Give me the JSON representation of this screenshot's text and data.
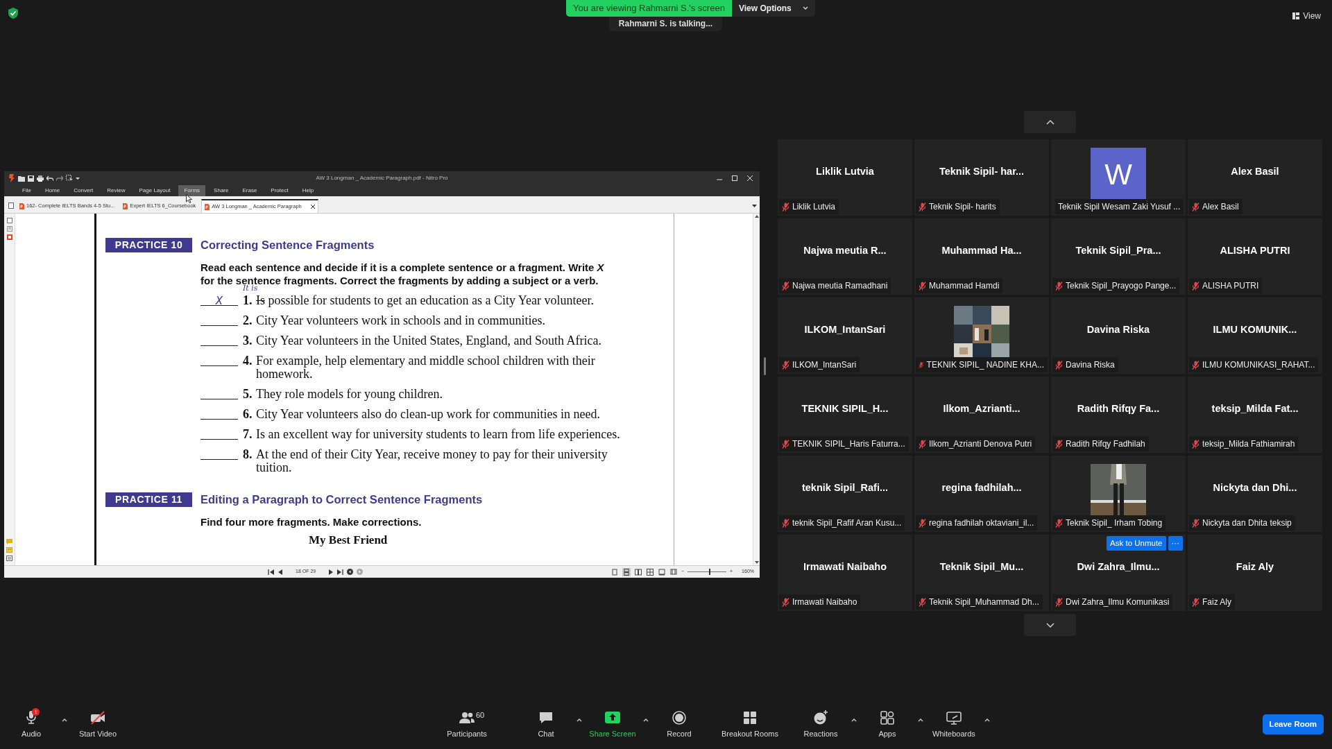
{
  "banner": {
    "text": "You are viewing Rahmarni S.'s screen",
    "options": "View Options"
  },
  "talking": "Rahmarni S. is talking...",
  "view_button": "View",
  "document_window": {
    "title": "AW 3 Longman _ Academic Paragraph.pdf - Nitro Pro",
    "ribbon": [
      {
        "label": "File",
        "selected": false
      },
      {
        "label": "Home",
        "selected": false
      },
      {
        "label": "Convert",
        "selected": false
      },
      {
        "label": "Review",
        "selected": false
      },
      {
        "label": "Page Layout",
        "selected": false
      },
      {
        "label": "Forms",
        "selected": true
      },
      {
        "label": "Share",
        "selected": false
      },
      {
        "label": "Erase",
        "selected": false
      },
      {
        "label": "Protect",
        "selected": false
      },
      {
        "label": "Help",
        "selected": false
      }
    ],
    "tabs": [
      {
        "label": "162- Complete IELTS Bands 4-5 Stu...",
        "selected": false
      },
      {
        "label": "Expert IELTS 6_Coursebook",
        "selected": false
      },
      {
        "label": "AW 3 Longman _ Academic Paragraph",
        "selected": true
      }
    ],
    "page": {
      "practices": [
        {
          "badge": "PRACTICE 10",
          "title": "Correcting Sentence Fragments",
          "instructions": "Read each sentence and decide if it is a complete sentence or a fragment. Write *X* for the sentence fragments. Correct the fragments by adding a subject or a verb.",
          "items": [
            {
              "number": "1.",
              "answer": "X",
              "correction": "It is",
              "struck": "Is",
              "text": "possible for students to get an education as a City Year volunteer."
            },
            {
              "number": "2.",
              "text": "City Year volunteers work in schools and in communities."
            },
            {
              "number": "3.",
              "text": "City Year volunteers in the United States, England, and South Africa."
            },
            {
              "number": "4.",
              "text": "For example, help elementary and middle school children with their homework."
            },
            {
              "number": "5.",
              "text": "They role models for young children."
            },
            {
              "number": "6.",
              "text": "City Year volunteers also do clean-up work for communities in need."
            },
            {
              "number": "7.",
              "text": "Is an excellent way for university students to learn from life experiences."
            },
            {
              "number": "8.",
              "text": "At the end of their City Year, receive money to pay for their university tuition."
            }
          ]
        },
        {
          "badge": "PRACTICE 11",
          "title": "Editing a Paragraph to Correct Sentence Fragments",
          "instructions": "Find four more fragments. Make corrections."
        }
      ],
      "subheading": "My Best Friend"
    },
    "status": {
      "page_counter": "18 OF 29",
      "history": [
        {
          "disabled": false
        },
        {
          "disabled": true
        }
      ],
      "view_modes": [
        {
          "selected": false
        },
        {
          "selected": true
        },
        {
          "selected": false
        },
        {
          "selected": false
        },
        {
          "selected": false
        },
        {
          "selected": false
        }
      ],
      "zoom_minus": "−",
      "zoom_plus": "+",
      "zoom": {
        "level": 0.58
      },
      "zoom_text": "160%"
    }
  },
  "participants": [
    {
      "kind": "name",
      "title": "Liklik Lutvia",
      "name": "Liklik Lutvia",
      "muted": true
    },
    {
      "kind": "name",
      "title": "Teknik Sipil- har...",
      "name": "Teknik Sipil- harits",
      "muted": true
    },
    {
      "kind": "avatar",
      "avatar": "W",
      "name": "Teknik Sipil Wesam Zaki Yusuf ...",
      "muted": false
    },
    {
      "kind": "name",
      "title": "Alex Basil",
      "name": "Alex Basil",
      "muted": true
    },
    {
      "kind": "name",
      "title": "Najwa meutia R...",
      "name": "Najwa meutia Ramadhani",
      "muted": true
    },
    {
      "kind": "name",
      "title": "Muhammad Ha...",
      "name": "Muhammad Hamdi",
      "muted": true
    },
    {
      "kind": "name",
      "title": "Teknik Sipil_Pra...",
      "name": "Teknik Sipil_Prayogo Pange...",
      "muted": true
    },
    {
      "kind": "name",
      "title": "ALISHA PUTRI",
      "name": "ALISHA PUTRI",
      "muted": true
    },
    {
      "kind": "name",
      "title": "ILKOM_IntanSari",
      "name": "ILKOM_IntanSari",
      "muted": true
    },
    {
      "kind": "picture",
      "name": "TEKNIK SIPIL_ NADINE KHA...",
      "muted": true
    },
    {
      "kind": "name",
      "title": "Davina Riska",
      "name": "Davina Riska",
      "muted": true
    },
    {
      "kind": "name",
      "title": "ILMU KOMUNIK...",
      "name": "ILMU KOMUNIKASI_RAHAT...",
      "muted": true
    },
    {
      "kind": "name",
      "title": "TEKNIK SIPIL_H...",
      "name": "TEKNIK SIPIL_Haris Faturra...",
      "muted": true
    },
    {
      "kind": "name",
      "title": "Ilkom_Azrianti...",
      "name": "Ilkom_Azrianti Denova Putri",
      "muted": true
    },
    {
      "kind": "name",
      "title": "Radith Rifqy Fa...",
      "name": "Radith Rifqy Fadhilah",
      "muted": true
    },
    {
      "kind": "name",
      "title": "teksip_Milda Fat...",
      "name": "teksip_Milda Fathiamirah",
      "muted": true
    },
    {
      "kind": "name",
      "title": "teknik Sipil_Rafi...",
      "name": "teknik Sipil_Rafif Aran Kusu...",
      "muted": true
    },
    {
      "kind": "name",
      "title": "regina fadhilah...",
      "name": "regina fadhilah oktaviani_il...",
      "muted": true
    },
    {
      "kind": "picture",
      "name": "Teknik Sipil_ Irham Tobing",
      "muted": true
    },
    {
      "kind": "name",
      "title": "Nickyta dan Dhi...",
      "name": "Nickyta dan Dhita teksip",
      "muted": true
    },
    {
      "kind": "name",
      "title": "Irmawati Naibaho",
      "name": "Irmawati Naibaho",
      "muted": true
    },
    {
      "kind": "name",
      "title": "Teknik Sipil_Mu...",
      "name": "Teknik Sipil_Muhammad Dh...",
      "muted": true
    },
    {
      "kind": "name",
      "title": "Dwi Zahra_Ilmu...",
      "name": "Dwi Zahra_Ilmu Komunikasi",
      "muted": true,
      "actions": {
        "ask": "Ask to Unmute",
        "more": "···"
      }
    },
    {
      "kind": "name",
      "title": "Faiz Aly",
      "name": "Faiz Aly",
      "muted": true
    }
  ],
  "toolbar": [
    {
      "kind": "audio",
      "label": "Audio",
      "alert": "!",
      "caret": true
    },
    {
      "kind": "video",
      "label": "Start Video",
      "caret": false
    },
    {
      "kind": "participants",
      "label": "Participants",
      "count": "60",
      "caret": false
    },
    {
      "kind": "chat",
      "label": "Chat",
      "caret": true
    },
    {
      "kind": "share",
      "label": "Share Screen",
      "caret": true
    },
    {
      "kind": "record",
      "label": "Record",
      "caret": false
    },
    {
      "kind": "breakout",
      "label": "Breakout Rooms",
      "caret": false
    },
    {
      "kind": "reactions",
      "label": "Reactions",
      "caret": true
    },
    {
      "kind": "apps",
      "label": "Apps",
      "caret": true
    },
    {
      "kind": "whiteboard",
      "label": "Whiteboards",
      "caret": true
    }
  ],
  "leave": "Leave Room"
}
